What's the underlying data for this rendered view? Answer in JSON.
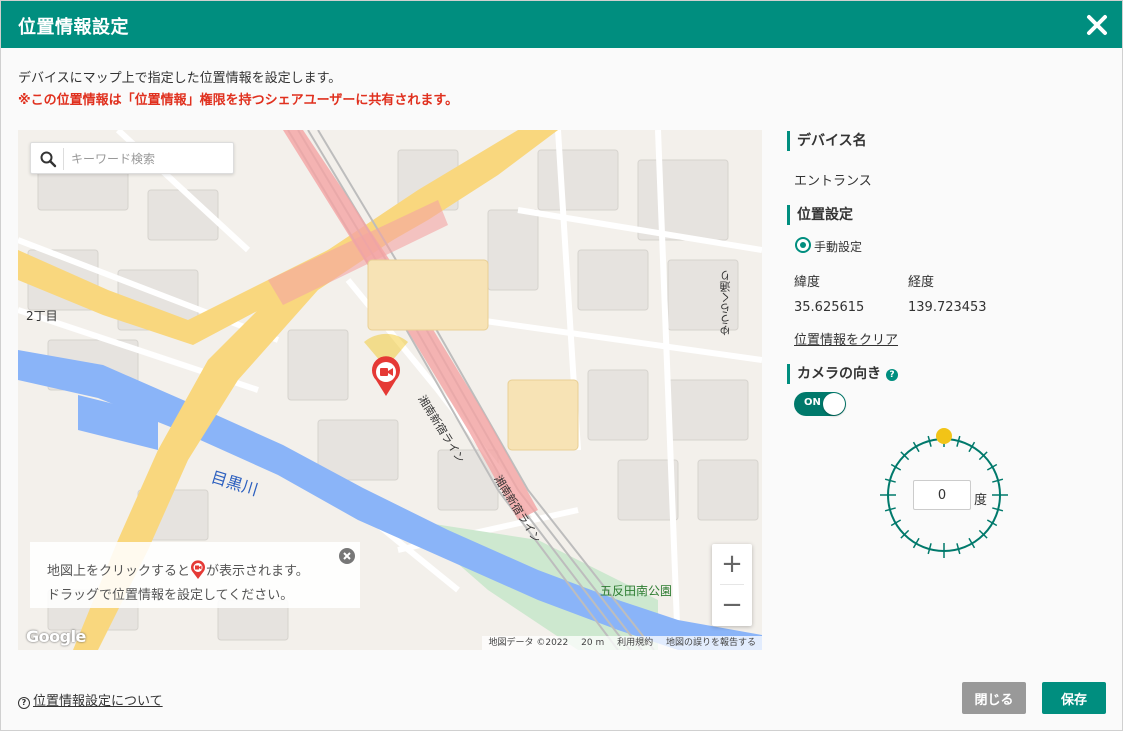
{
  "dialog": {
    "title": "位置情報設定",
    "description": "デバイスにマップ上で指定した位置情報を設定します。",
    "warning": "※この位置情報は「位置情報」権限を持つシェアユーザーに共有されます。"
  },
  "map": {
    "search_placeholder": "キーワード検索",
    "hint_line1_before": "地図上をクリックすると",
    "hint_line1_after": "が表示されます。",
    "hint_line2": "ドラッグで位置情報を設定してください。",
    "labels": {
      "area": "2丁目",
      "river": "目黒川",
      "park": "五反田南公園",
      "rail1": "湘南新宿ライン",
      "rail2": "湘南新宿ライン",
      "street": "ゆうらく通り"
    },
    "attribution": {
      "data": "地図データ ©2022",
      "scale": "20 m",
      "terms": "利用規約",
      "report": "地図の誤りを報告する"
    },
    "logo": "Google",
    "zoom_in": "+",
    "zoom_out": "−"
  },
  "panel": {
    "device_name_heading": "デバイス名",
    "device_name": "エントランス",
    "location_heading": "位置設定",
    "manual_label": "手動設定",
    "lat_label": "緯度",
    "lng_label": "経度",
    "lat_value": "35.625615",
    "lng_value": "139.723453",
    "clear_link": "位置情報をクリア",
    "camera_heading": "カメラの向き",
    "help_glyph": "?",
    "toggle_label": "ON",
    "direction_value": "0",
    "direction_unit": "度"
  },
  "footer": {
    "help_link": "位置情報設定について",
    "help_glyph": "?",
    "close_button": "閉じる",
    "save_button": "保存"
  },
  "colors": {
    "accent": "#008e7f",
    "warning": "#e0301e",
    "road_major": "#f9d77e",
    "water": "#8ab4f8",
    "rail_highlight": "#f4a4a4",
    "dial_marker": "#f2c417"
  }
}
